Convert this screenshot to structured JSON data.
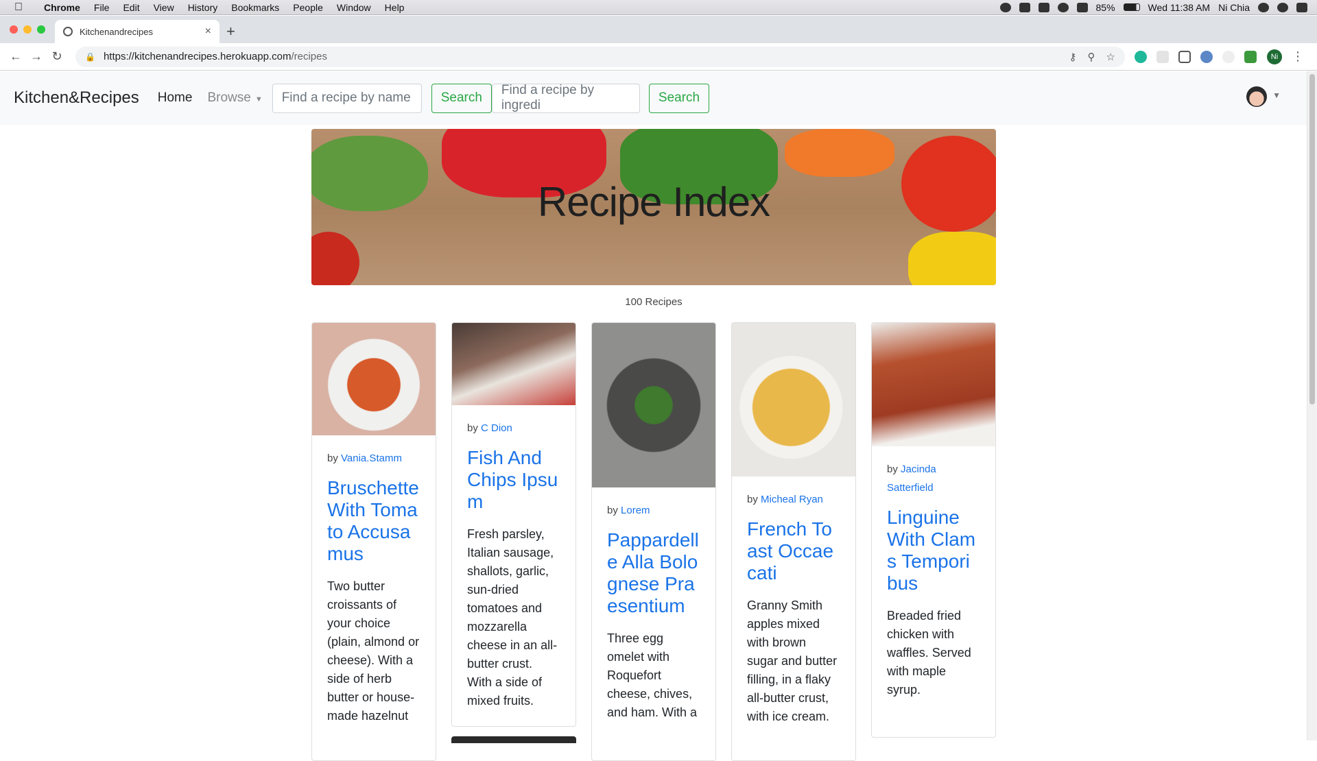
{
  "menubar": {
    "app": "Chrome",
    "items": [
      "File",
      "Edit",
      "View",
      "History",
      "Bookmarks",
      "People",
      "Window",
      "Help"
    ],
    "battery": "85%",
    "clock": "Wed 11:38 AM",
    "user": "Ni Chia"
  },
  "browser": {
    "tab_title": "Kitchenandrecipes",
    "url_host": "https://kitchenandrecipes.herokuapp.com",
    "url_path": "/recipes",
    "profile_initials": "Ni"
  },
  "nav": {
    "brand": "Kitchen&Recipes",
    "home": "Home",
    "browse": "Browse",
    "search_name_placeholder": "Find a recipe by name",
    "search_ingredient_placeholder": "Find a recipe by ingredi",
    "search_label": "Search"
  },
  "hero": {
    "title": "Recipe Index"
  },
  "recipe_count": "100 Recipes",
  "cards": [
    {
      "author_prefix": "by",
      "author": "Vania.Stamm",
      "title": "Bruschette With Tomato Accusamus",
      "text": "Two butter croissants of your choice (plain, almond or cheese). With a side of herb butter or house-made hazelnut"
    },
    {
      "author_prefix": "by",
      "author": "C Dion",
      "title": "Fish And Chips Ipsum",
      "text": "Fresh parsley, Italian sausage, shallots, garlic, sun-dried tomatoes and mozzarella cheese in an all-butter crust. With a side of mixed fruits."
    },
    {
      "author_prefix": "by",
      "author": "Lorem",
      "title": "Pappardelle Alla Bolognese Praesentium",
      "text": "Three egg omelet with Roquefort cheese, chives, and ham. With a"
    },
    {
      "author_prefix": "by",
      "author": "Micheal Ryan",
      "title": "French Toast Occaecati",
      "text": "Granny Smith apples mixed with brown sugar and butter filling, in a flaky all-butter crust, with ice cream."
    },
    {
      "author_prefix": "by",
      "author": "Jacinda Satterfield",
      "title": "Linguine With Clams Temporibus",
      "text": "Breaded fried chicken with waffles. Served with maple syrup."
    }
  ]
}
